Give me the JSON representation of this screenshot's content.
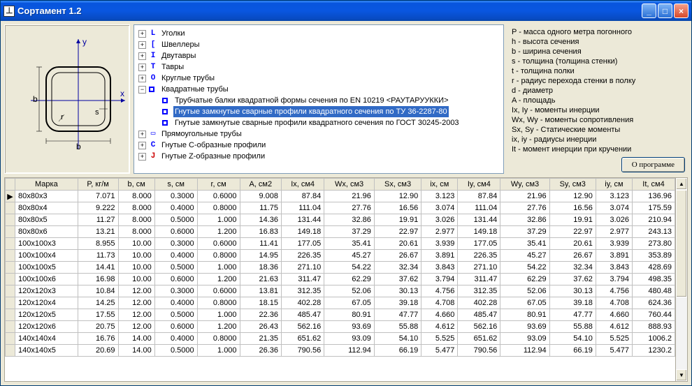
{
  "titlebar": {
    "title": "Сортамент 1.2"
  },
  "tree": {
    "items": [
      {
        "level": 0,
        "exp": "+",
        "icon": "L",
        "iclass": "blue",
        "label": "Уголки"
      },
      {
        "level": 0,
        "exp": "+",
        "icon": "[",
        "iclass": "blue",
        "label": "Швеллеры"
      },
      {
        "level": 0,
        "exp": "+",
        "icon": "I",
        "iclass": "blue",
        "label": "Двутавры"
      },
      {
        "level": 0,
        "exp": "+",
        "icon": "T",
        "iclass": "blue",
        "label": "Тавры"
      },
      {
        "level": 0,
        "exp": "+",
        "icon": "O",
        "iclass": "blue",
        "label": "Круглые трубы"
      },
      {
        "level": 0,
        "exp": "−",
        "icon": "sq",
        "iclass": "blue",
        "label": "Квадратные трубы"
      },
      {
        "level": 1,
        "exp": "",
        "icon": "sq",
        "iclass": "blue",
        "label": "Трубчатые балки квадратной формы сечения по EN 10219 <РАУТАРУУККИ>"
      },
      {
        "level": 1,
        "exp": "",
        "icon": "sq",
        "iclass": "blue",
        "label": "Гнутые замкнутые сварные профили квадратного сечения по ТУ 36-2287-80",
        "selected": true
      },
      {
        "level": 1,
        "exp": "",
        "icon": "sq",
        "iclass": "blue",
        "label": "Гнутые замкнутые сварные профили квадратного сечения по ГОСТ 30245-2003"
      },
      {
        "level": 0,
        "exp": "+",
        "icon": "▭",
        "iclass": "blue",
        "label": "Прямоугольные трубы"
      },
      {
        "level": 0,
        "exp": "+",
        "icon": "C",
        "iclass": "blue",
        "label": "Гнутые С-образные профили"
      },
      {
        "level": 0,
        "exp": "+",
        "icon": "J",
        "iclass": "red",
        "label": "Гнутые Z-образные профили"
      }
    ]
  },
  "legend": [
    "P - масса одного метра погонного",
    "h - высота сечения",
    "b - ширина сечения",
    "s - толщина (толщина стенки)",
    "t - толщина полки",
    "r - радиус перехода стенки в полку",
    "d - диаметр",
    "A - площадь",
    "Ix, Iy - моменты инерции",
    "Wx, Wy - моменты сопротивления",
    "Sx, Sy - Статические моменты",
    "ix, iy - радиусы инерции",
    "It - момент инерции при кручении"
  ],
  "buttons": {
    "about": "О программе"
  },
  "table": {
    "columns": [
      "Марка",
      "P, кг/м",
      "b, см",
      "s, см",
      "r, см",
      "A, см2",
      "Ix, см4",
      "Wx, см3",
      "Sx, см3",
      "ix, см",
      "Iy, см4",
      "Wy, см3",
      "Sy, см3",
      "iy, см",
      "It, см4"
    ],
    "rows": [
      [
        "80x80x3",
        "7.071",
        "8.000",
        "0.3000",
        "0.6000",
        "9.008",
        "87.84",
        "21.96",
        "12.90",
        "3.123",
        "87.84",
        "21.96",
        "12.90",
        "3.123",
        "136.96"
      ],
      [
        "80x80x4",
        "9.222",
        "8.000",
        "0.4000",
        "0.8000",
        "11.75",
        "111.04",
        "27.76",
        "16.56",
        "3.074",
        "111.04",
        "27.76",
        "16.56",
        "3.074",
        "175.59"
      ],
      [
        "80x80x5",
        "11.27",
        "8.000",
        "0.5000",
        "1.000",
        "14.36",
        "131.44",
        "32.86",
        "19.91",
        "3.026",
        "131.44",
        "32.86",
        "19.91",
        "3.026",
        "210.94"
      ],
      [
        "80x80x6",
        "13.21",
        "8.000",
        "0.6000",
        "1.200",
        "16.83",
        "149.18",
        "37.29",
        "22.97",
        "2.977",
        "149.18",
        "37.29",
        "22.97",
        "2.977",
        "243.13"
      ],
      [
        "100x100x3",
        "8.955",
        "10.00",
        "0.3000",
        "0.6000",
        "11.41",
        "177.05",
        "35.41",
        "20.61",
        "3.939",
        "177.05",
        "35.41",
        "20.61",
        "3.939",
        "273.80"
      ],
      [
        "100x100x4",
        "11.73",
        "10.00",
        "0.4000",
        "0.8000",
        "14.95",
        "226.35",
        "45.27",
        "26.67",
        "3.891",
        "226.35",
        "45.27",
        "26.67",
        "3.891",
        "353.89"
      ],
      [
        "100x100x5",
        "14.41",
        "10.00",
        "0.5000",
        "1.000",
        "18.36",
        "271.10",
        "54.22",
        "32.34",
        "3.843",
        "271.10",
        "54.22",
        "32.34",
        "3.843",
        "428.69"
      ],
      [
        "100x100x6",
        "16.98",
        "10.00",
        "0.6000",
        "1.200",
        "21.63",
        "311.47",
        "62.29",
        "37.62",
        "3.794",
        "311.47",
        "62.29",
        "37.62",
        "3.794",
        "498.35"
      ],
      [
        "120x120x3",
        "10.84",
        "12.00",
        "0.3000",
        "0.6000",
        "13.81",
        "312.35",
        "52.06",
        "30.13",
        "4.756",
        "312.35",
        "52.06",
        "30.13",
        "4.756",
        "480.48"
      ],
      [
        "120x120x4",
        "14.25",
        "12.00",
        "0.4000",
        "0.8000",
        "18.15",
        "402.28",
        "67.05",
        "39.18",
        "4.708",
        "402.28",
        "67.05",
        "39.18",
        "4.708",
        "624.36"
      ],
      [
        "120x120x5",
        "17.55",
        "12.00",
        "0.5000",
        "1.000",
        "22.36",
        "485.47",
        "80.91",
        "47.77",
        "4.660",
        "485.47",
        "80.91",
        "47.77",
        "4.660",
        "760.44"
      ],
      [
        "120x120x6",
        "20.75",
        "12.00",
        "0.6000",
        "1.200",
        "26.43",
        "562.16",
        "93.69",
        "55.88",
        "4.612",
        "562.16",
        "93.69",
        "55.88",
        "4.612",
        "888.93"
      ],
      [
        "140x140x4",
        "16.76",
        "14.00",
        "0.4000",
        "0.8000",
        "21.35",
        "651.62",
        "93.09",
        "54.10",
        "5.525",
        "651.62",
        "93.09",
        "54.10",
        "5.525",
        "1006.2"
      ],
      [
        "140x140x5",
        "20.69",
        "14.00",
        "0.5000",
        "1.000",
        "26.36",
        "790.56",
        "112.94",
        "66.19",
        "5.477",
        "790.56",
        "112.94",
        "66.19",
        "5.477",
        "1230.2"
      ]
    ]
  }
}
